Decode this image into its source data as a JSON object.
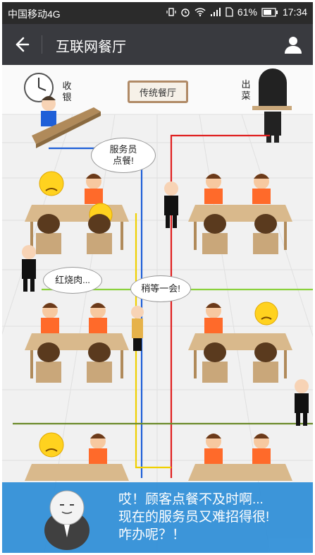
{
  "status_bar": {
    "carrier": "中国移动4G",
    "battery": "61%",
    "time": "17:34",
    "network": "4G"
  },
  "nav": {
    "title": "互联网餐厅"
  },
  "scene": {
    "cashier_label": "收银",
    "serve_label": "出菜",
    "sign": "传统餐厅",
    "bubble_waiter": "服务员\n点餐!",
    "bubble_food": "红烧肉...",
    "bubble_wait": "稍等一会!",
    "banner_text": "哎！顾客点餐不及时啊...\n现在的服务员又难招得很!\n咋办呢？！"
  },
  "colors": {
    "status_bar": "#2b2b2b",
    "nav_bar": "#393a3f",
    "banner": "#2f8fd8",
    "table": "#d9b98c",
    "chair": "#c9a77a",
    "blue_line": "#1e5fd8",
    "red_line": "#e02020",
    "yellow_line": "#f0d000",
    "green_line": "#8bd13c"
  }
}
